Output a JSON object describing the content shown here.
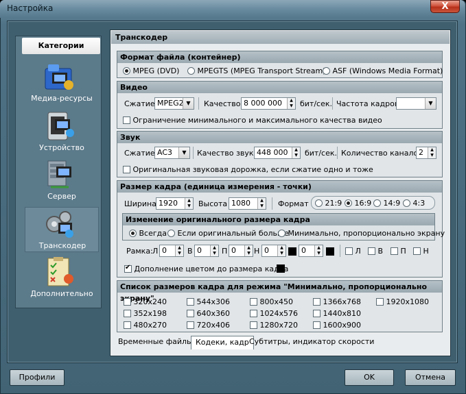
{
  "window": {
    "title": "Настройка",
    "close_label": "X"
  },
  "sidebar": {
    "header": "Категории",
    "items": [
      {
        "label": "Медиа-ресурсы",
        "icon": "media-folder-icon"
      },
      {
        "label": "Устройство",
        "icon": "device-icon"
      },
      {
        "label": "Сервер",
        "icon": "server-icon"
      },
      {
        "label": "Транскодер",
        "icon": "transcoder-gears-icon",
        "selected": true
      },
      {
        "label": "Дополнительно",
        "icon": "checklist-icon"
      }
    ]
  },
  "main": {
    "title": "Транскодер",
    "format": {
      "header": "Формат файла (контейнер)",
      "options": [
        "MPEG (DVD)",
        "MPEGTS (MPEG Transport Stream)",
        "ASF (Windows Media Format)"
      ],
      "selected": "MPEG (DVD)"
    },
    "video": {
      "header": "Видео",
      "compression_label": "Сжатие",
      "compression_value": "MPEG2",
      "quality_label": "Качество",
      "quality_value": "8 000 000",
      "quality_unit": "бит/сек.",
      "framerate_label": "Частота кадров",
      "framerate_value": "",
      "limit_label": "Ограничение минимального и максимального качества видео"
    },
    "audio": {
      "header": "Звук",
      "compression_label": "Сжатие",
      "compression_value": "AC3",
      "quality_label": "Качество звука",
      "quality_value": "448 000",
      "quality_unit": "бит/сек.",
      "channels_label": "Количество каналов",
      "channels_value": "2",
      "original_label": "Оригинальная звуковая дорожка, если сжатие одно и тоже"
    },
    "frame": {
      "header": "Размер кадра (единица измерения - точки)",
      "width_label": "Ширина",
      "width_value": "1920",
      "height_label": "Высота",
      "height_value": "1080",
      "format_label": "Формат",
      "format_options": [
        "21:9",
        "16:9",
        "14:9",
        "4:3"
      ],
      "format_selected": "16:9",
      "resize_header": "Изменение оригинального размера кадра",
      "resize_options": [
        "Всегда",
        "Если оригинальный больше",
        "Минимально, пропорционально экрану"
      ],
      "resize_selected": "Всегда",
      "border_label": "Рамка:",
      "border_fields": [
        {
          "label": "Л",
          "value": "0"
        },
        {
          "label": "В",
          "value": "0"
        },
        {
          "label": "П",
          "value": "0"
        },
        {
          "label": "Н",
          "value": "0"
        }
      ],
      "border_checks": [
        "Л",
        "В",
        "П",
        "Н"
      ],
      "fill_label": "Дополнение цветом до размера кадра",
      "fill_color": "#000000"
    },
    "sizes": {
      "header": "Список размеров кадра для режима \"Минимально, пропорционально экрану\"",
      "items": [
        "320x240",
        "544x306",
        "800x450",
        "1366x768",
        "1920x1080",
        "352x198",
        "640x360",
        "1024x576",
        "1440x810",
        "480x270",
        "720x406",
        "1280x720",
        "1600x900"
      ]
    },
    "tabs": [
      "Временные файлы",
      "Кодеки, кадр",
      "Субтитры, индикатор скорости"
    ],
    "active_tab": "Кодеки, кадр"
  },
  "buttons": {
    "profiles": "Профили",
    "ok": "OK",
    "cancel": "Отмена"
  },
  "colors": {
    "accent": "#4f7286",
    "panel": "#e1e5e8",
    "close": "#c9553a"
  }
}
